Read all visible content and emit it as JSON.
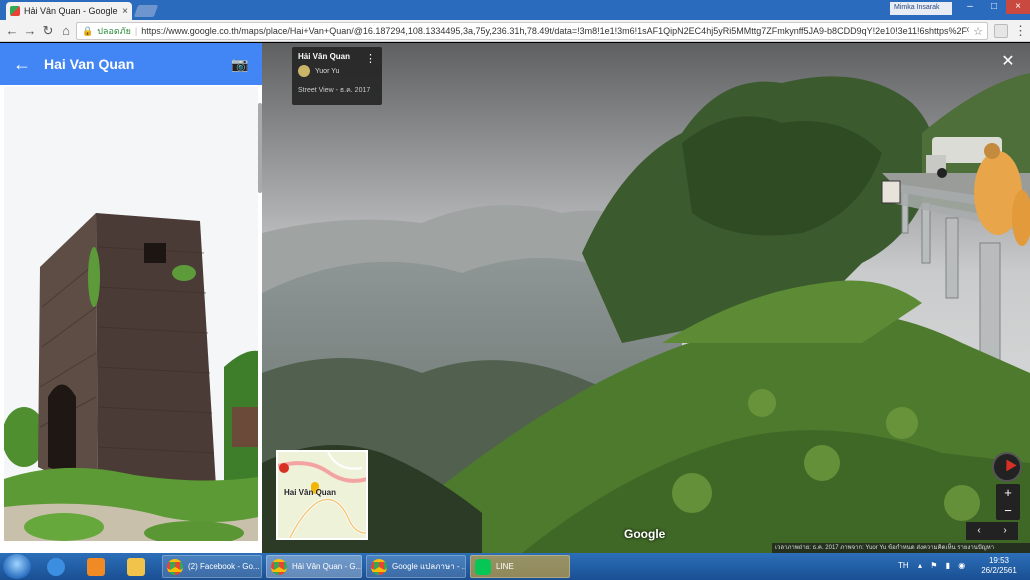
{
  "browser": {
    "tab_title": "Hải Vân Quan - Google",
    "tab_close": "×",
    "user_label": "Mimka Insarak",
    "security_label": "ปลอดภัย",
    "url": "https://www.google.co.th/maps/place/Hai+Van+Quan/@16.187294,108.1334495,3a,75y,236.31h,78.49t/data=!3m8!1e1!3m6!1sAF1QipN2EC4hj5yRi5MMttg7ZFmkynff5JA9-b8CDD9qY!2e10!3e11!6shttps%2F%..."
  },
  "panel": {
    "title": "Hai Van Quan",
    "back_glyph": "←",
    "camera_glyph": "📷"
  },
  "streetview": {
    "place_name": "Hải Vân Quan",
    "author": "Yuor Yu",
    "date_label": "Street View - ธ.ค. 2017",
    "close_glyph": "✕",
    "collapse_glyph": "◀",
    "minimap_label": "Hai Vân Quan",
    "google_logo": "Google",
    "zoom_in": "+",
    "zoom_out": "−",
    "prev": "‹",
    "next": "›",
    "footer": "เวลาภาพถ่าย: ธ.ค. 2017   ภาพจาก: Yuor Yu   ข้อกำหนด   ส่งความคิดเห็น   รายงานปัญหา"
  },
  "taskbar": {
    "tasks": [
      "(2) Facebook - Go...",
      "Hải Vân Quan - G...",
      "Google แปลภาษา - ...",
      "LINE"
    ],
    "lang": "TH",
    "time": "19:53",
    "date": "26/2/2561"
  },
  "colors": {
    "maps_blue": "#4285f4",
    "taskbar": "#2c6fb8"
  }
}
